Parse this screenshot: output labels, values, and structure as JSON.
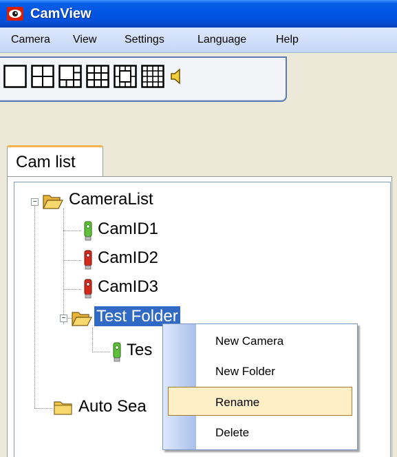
{
  "window": {
    "title": "CamView",
    "icon": "camera-eye-icon"
  },
  "menu": [
    "Camera",
    "View",
    "Settings",
    "Language",
    "Help"
  ],
  "toolbar": {
    "buttons": [
      "layout-1-icon",
      "layout-4-icon",
      "layout-6-icon",
      "layout-9-icon",
      "layout-13-icon",
      "layout-16-icon",
      "speaker-icon"
    ]
  },
  "tabs": {
    "active": "Cam list"
  },
  "tree": {
    "root": "CameraList",
    "cams": [
      "CamID1",
      "CamID2",
      "CamID3"
    ],
    "folder": "Test Folder",
    "folder_child": "Tes",
    "auto": "Auto Sea"
  },
  "context_menu": {
    "items": [
      "New Camera",
      "New Folder",
      "Rename",
      "Delete"
    ],
    "highlighted": "Rename"
  },
  "colors": {
    "title_bar": "#0054e3",
    "selection": "#316ac5",
    "menu_hover": "#ffefc7",
    "cam_online": "#4caf50",
    "cam_offline": "#d32f2f",
    "folder": "#f4c542"
  }
}
